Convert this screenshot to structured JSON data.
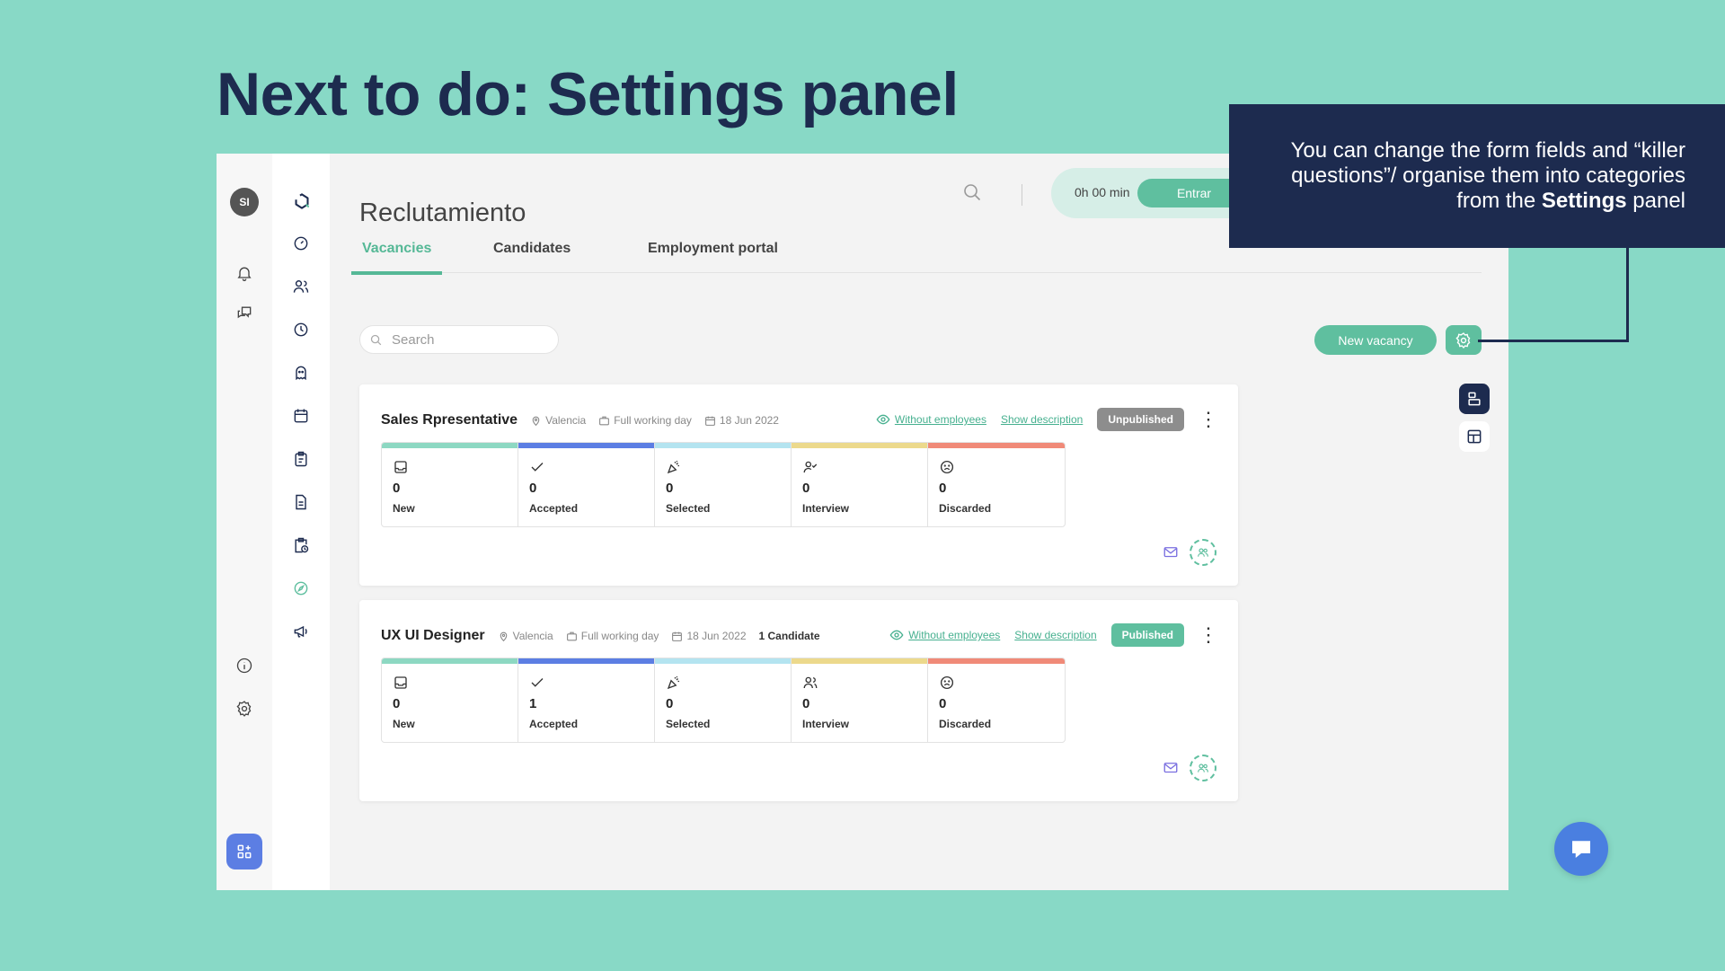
{
  "headline": "Next to do: Settings panel",
  "callout": {
    "text_before": "You can change the form fields and “killer questions”/ organise them into categories from the ",
    "bold": "Settings",
    "text_after": " panel"
  },
  "user": {
    "initials": "SI"
  },
  "header": {
    "page_title": "Reclutamiento",
    "time_text": "0h 00 min",
    "enter_label": "Entrar"
  },
  "tabs": [
    {
      "label": "Vacancies"
    },
    {
      "label": "Candidates"
    },
    {
      "label": "Employment portal"
    }
  ],
  "toolbar": {
    "search_placeholder": "Search",
    "new_vacancy_label": "New vacancy"
  },
  "colors": {
    "brand": "#5fbf9f",
    "navy": "#1d2b4f",
    "stage_new": "#8dd8c2",
    "stage_accepted": "#5c7ee3",
    "stage_selected": "#b4e4f0",
    "stage_interview": "#ecd98c",
    "stage_discarded": "#f08a78"
  },
  "vacancies": [
    {
      "title": "Sales Rpresentative",
      "location": "Valencia",
      "schedule": "Full working day",
      "date": "18 Jun 2022",
      "candidates": "",
      "without_employees": "Without employees",
      "show_description": "Show description",
      "status": "Unpublished",
      "stages": [
        {
          "count": "0",
          "label": "New"
        },
        {
          "count": "0",
          "label": "Accepted"
        },
        {
          "count": "0",
          "label": "Selected"
        },
        {
          "count": "0",
          "label": "Interview"
        },
        {
          "count": "0",
          "label": "Discarded"
        }
      ]
    },
    {
      "title": "UX UI Designer",
      "location": "Valencia",
      "schedule": "Full working day",
      "date": "18 Jun 2022",
      "candidates": "1 Candidate",
      "without_employees": "Without employees",
      "show_description": "Show description",
      "status": "Published",
      "stages": [
        {
          "count": "0",
          "label": "New"
        },
        {
          "count": "1",
          "label": "Accepted"
        },
        {
          "count": "0",
          "label": "Selected"
        },
        {
          "count": "0",
          "label": "Interview"
        },
        {
          "count": "0",
          "label": "Discarded"
        }
      ]
    }
  ]
}
